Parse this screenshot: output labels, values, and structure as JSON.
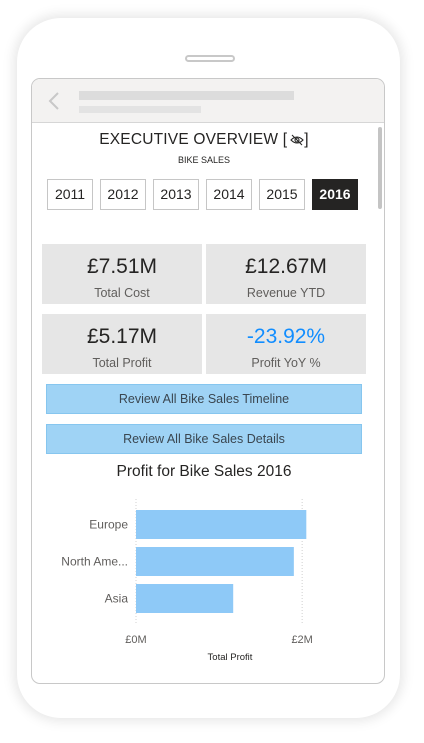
{
  "report": {
    "title": "EXECUTIVE OVERVIEW [",
    "title_close": "]",
    "subtitle": "BIKE SALES"
  },
  "years": [
    {
      "label": "2011",
      "selected": false
    },
    {
      "label": "2012",
      "selected": false
    },
    {
      "label": "2013",
      "selected": false
    },
    {
      "label": "2014",
      "selected": false
    },
    {
      "label": "2015",
      "selected": false
    },
    {
      "label": "2016",
      "selected": true
    }
  ],
  "kpis": [
    {
      "value": "£7.51M",
      "label": "Total Cost"
    },
    {
      "value": "£12.67M",
      "label": "Revenue YTD"
    },
    {
      "value": "£5.17M",
      "label": "Total Profit"
    },
    {
      "value": "-23.92%",
      "label": "Profit YoY %"
    }
  ],
  "buttons": {
    "timeline": "Review All Bike Sales Timeline",
    "details": "Review All Bike Sales Details"
  },
  "colors": {
    "bar": "#8ec9f7",
    "kpi_negative": "#118dff",
    "button": "#9fd3f5",
    "selected_year": "#252423"
  },
  "chart_data": {
    "type": "bar",
    "orientation": "horizontal",
    "title": "Profit for Bike Sales 2016",
    "categories": [
      "Europe",
      "North Ame...",
      "Asia"
    ],
    "values": [
      2.05,
      1.9,
      1.17
    ],
    "xlabel": "Total Profit",
    "ylabel": "",
    "xlim": [
      0,
      2.6
    ],
    "x_ticks": [
      {
        "value": 0,
        "label": "£0M"
      },
      {
        "value": 2,
        "label": "£2M"
      }
    ],
    "grid": true,
    "legend": "none"
  }
}
